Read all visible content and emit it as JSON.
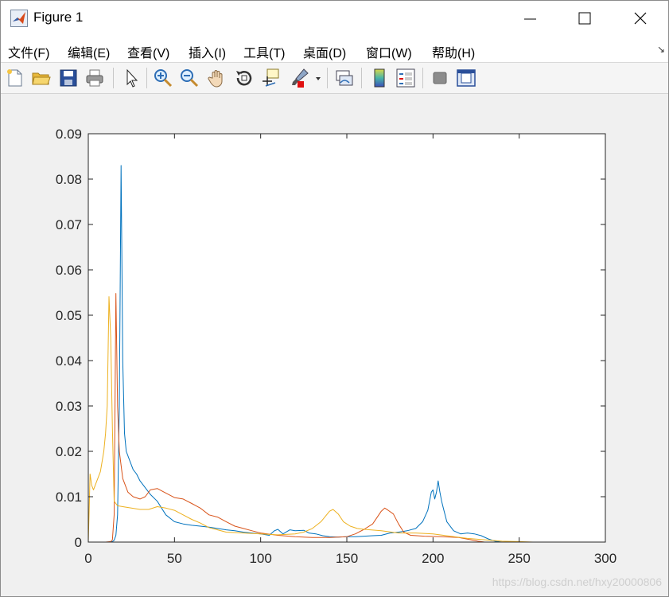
{
  "window": {
    "title": "Figure 1",
    "icon": "matlab-icon"
  },
  "menu": {
    "items": [
      "文件(F)",
      "编辑(E)",
      "查看(V)",
      "插入(I)",
      "工具(T)",
      "桌面(D)",
      "窗口(W)",
      "帮助(H)"
    ]
  },
  "toolbar": {
    "icons": [
      "new-figure-icon",
      "open-file-icon",
      "save-icon",
      "print-icon",
      "select-arrow-icon",
      "zoom-in-icon",
      "zoom-out-icon",
      "pan-hand-icon",
      "rotate-3d-icon",
      "data-cursor-icon",
      "brush-icon",
      "link-plot-icon",
      "colorbar-icon",
      "legend-icon",
      "hide-plot-tools-icon",
      "show-plot-tools-icon"
    ]
  },
  "watermark": "https://blog.csdn.net/hxy20000806",
  "colors": {
    "series1": "#0072BD",
    "series2": "#D95319",
    "series3": "#EDB120"
  },
  "chart_data": {
    "type": "line",
    "title": "",
    "xlabel": "",
    "ylabel": "",
    "xlim": [
      0,
      300
    ],
    "ylim": [
      0,
      0.09
    ],
    "xticks": [
      0,
      50,
      100,
      150,
      200,
      250,
      300
    ],
    "yticks": [
      0,
      0.01,
      0.02,
      0.03,
      0.04,
      0.05,
      0.06,
      0.07,
      0.08,
      0.09
    ],
    "grid": false,
    "series": [
      {
        "color": "#0072BD",
        "points": [
          [
            0,
            0
          ],
          [
            12,
            0
          ],
          [
            14,
            0.0001
          ],
          [
            15,
            0.0004
          ],
          [
            16,
            0.0015
          ],
          [
            17,
            0.006
          ],
          [
            18,
            0.03
          ],
          [
            19,
            0.083
          ],
          [
            20,
            0.04
          ],
          [
            21,
            0.024
          ],
          [
            22,
            0.02
          ],
          [
            24,
            0.018
          ],
          [
            26,
            0.016
          ],
          [
            28,
            0.015
          ],
          [
            30,
            0.0135
          ],
          [
            33,
            0.012
          ],
          [
            36,
            0.0105
          ],
          [
            40,
            0.009
          ],
          [
            45,
            0.006
          ],
          [
            50,
            0.0045
          ],
          [
            55,
            0.004
          ],
          [
            60,
            0.0037
          ],
          [
            65,
            0.0035
          ],
          [
            70,
            0.0033
          ],
          [
            75,
            0.003
          ],
          [
            80,
            0.0027
          ],
          [
            85,
            0.0025
          ],
          [
            90,
            0.0022
          ],
          [
            95,
            0.002
          ],
          [
            100,
            0.0018
          ],
          [
            105,
            0.0015
          ],
          [
            108,
            0.0025
          ],
          [
            110,
            0.0028
          ],
          [
            113,
            0.0018
          ],
          [
            117,
            0.0027
          ],
          [
            120,
            0.0025
          ],
          [
            125,
            0.0026
          ],
          [
            128,
            0.002
          ],
          [
            132,
            0.0018
          ],
          [
            136,
            0.0014
          ],
          [
            140,
            0.0012
          ],
          [
            145,
            0.0011
          ],
          [
            150,
            0.0012
          ],
          [
            155,
            0.0012
          ],
          [
            160,
            0.0013
          ],
          [
            165,
            0.0014
          ],
          [
            170,
            0.0015
          ],
          [
            175,
            0.002
          ],
          [
            180,
            0.0022
          ],
          [
            185,
            0.0025
          ],
          [
            190,
            0.003
          ],
          [
            194,
            0.0045
          ],
          [
            197,
            0.007
          ],
          [
            199,
            0.011
          ],
          [
            200,
            0.0115
          ],
          [
            201,
            0.0095
          ],
          [
            202,
            0.011
          ],
          [
            203,
            0.0135
          ],
          [
            204,
            0.011
          ],
          [
            205,
            0.009
          ],
          [
            206,
            0.0075
          ],
          [
            208,
            0.0045
          ],
          [
            212,
            0.0025
          ],
          [
            216,
            0.0018
          ],
          [
            220,
            0.002
          ],
          [
            224,
            0.0018
          ],
          [
            228,
            0.0014
          ],
          [
            232,
            0.0007
          ],
          [
            236,
            0.0002
          ],
          [
            240,
            0
          ],
          [
            300,
            0
          ]
        ]
      },
      {
        "color": "#D95319",
        "points": [
          [
            0,
            0
          ],
          [
            10,
            0
          ],
          [
            13,
            0.0001
          ],
          [
            14,
            0.0005
          ],
          [
            15,
            0.006
          ],
          [
            16,
            0.0548
          ],
          [
            17,
            0.03
          ],
          [
            18,
            0.02
          ],
          [
            20,
            0.014
          ],
          [
            23,
            0.011
          ],
          [
            26,
            0.01
          ],
          [
            30,
            0.0095
          ],
          [
            33,
            0.01
          ],
          [
            36,
            0.0115
          ],
          [
            40,
            0.0118
          ],
          [
            45,
            0.0108
          ],
          [
            50,
            0.0098
          ],
          [
            55,
            0.0095
          ],
          [
            60,
            0.0085
          ],
          [
            65,
            0.0075
          ],
          [
            70,
            0.006
          ],
          [
            75,
            0.0055
          ],
          [
            80,
            0.0045
          ],
          [
            85,
            0.0035
          ],
          [
            90,
            0.003
          ],
          [
            95,
            0.0025
          ],
          [
            100,
            0.002
          ],
          [
            110,
            0.0015
          ],
          [
            120,
            0.0012
          ],
          [
            130,
            0.001
          ],
          [
            140,
            0.001
          ],
          [
            150,
            0.0012
          ],
          [
            155,
            0.0018
          ],
          [
            160,
            0.0028
          ],
          [
            165,
            0.004
          ],
          [
            170,
            0.0068
          ],
          [
            172,
            0.0075
          ],
          [
            174,
            0.007
          ],
          [
            177,
            0.0062
          ],
          [
            180,
            0.004
          ],
          [
            183,
            0.0022
          ],
          [
            187,
            0.0015
          ],
          [
            195,
            0.0013
          ],
          [
            205,
            0.0012
          ],
          [
            215,
            0.001
          ],
          [
            222,
            0.0005
          ],
          [
            226,
            0.0002
          ],
          [
            230,
            0
          ],
          [
            300,
            0
          ]
        ]
      },
      {
        "color": "#EDB120",
        "points": [
          [
            0,
            0
          ],
          [
            0.5,
            0.007
          ],
          [
            1,
            0.015
          ],
          [
            2,
            0.0125
          ],
          [
            3,
            0.0115
          ],
          [
            5,
            0.0135
          ],
          [
            7,
            0.0155
          ],
          [
            9,
            0.02
          ],
          [
            10,
            0.024
          ],
          [
            11,
            0.03
          ],
          [
            12,
            0.0541
          ],
          [
            13,
            0.045
          ],
          [
            14,
            0.025
          ],
          [
            15,
            0.009
          ],
          [
            17,
            0.008
          ],
          [
            20,
            0.0078
          ],
          [
            25,
            0.0075
          ],
          [
            30,
            0.0072
          ],
          [
            35,
            0.0072
          ],
          [
            40,
            0.0078
          ],
          [
            45,
            0.0075
          ],
          [
            50,
            0.007
          ],
          [
            55,
            0.006
          ],
          [
            60,
            0.005
          ],
          [
            65,
            0.0042
          ],
          [
            70,
            0.0032
          ],
          [
            75,
            0.0027
          ],
          [
            80,
            0.0022
          ],
          [
            90,
            0.002
          ],
          [
            100,
            0.0018
          ],
          [
            110,
            0.0016
          ],
          [
            120,
            0.0018
          ],
          [
            125,
            0.0022
          ],
          [
            130,
            0.003
          ],
          [
            135,
            0.0045
          ],
          [
            140,
            0.0068
          ],
          [
            142,
            0.0072
          ],
          [
            145,
            0.0062
          ],
          [
            148,
            0.0045
          ],
          [
            152,
            0.0035
          ],
          [
            156,
            0.003
          ],
          [
            160,
            0.0028
          ],
          [
            170,
            0.0025
          ],
          [
            180,
            0.002
          ],
          [
            190,
            0.002
          ],
          [
            200,
            0.0018
          ],
          [
            210,
            0.0013
          ],
          [
            220,
            0.0008
          ],
          [
            230,
            0.0005
          ],
          [
            240,
            0.0002
          ],
          [
            250,
            0.0001
          ],
          [
            258,
            0
          ],
          [
            300,
            0
          ]
        ]
      }
    ]
  }
}
